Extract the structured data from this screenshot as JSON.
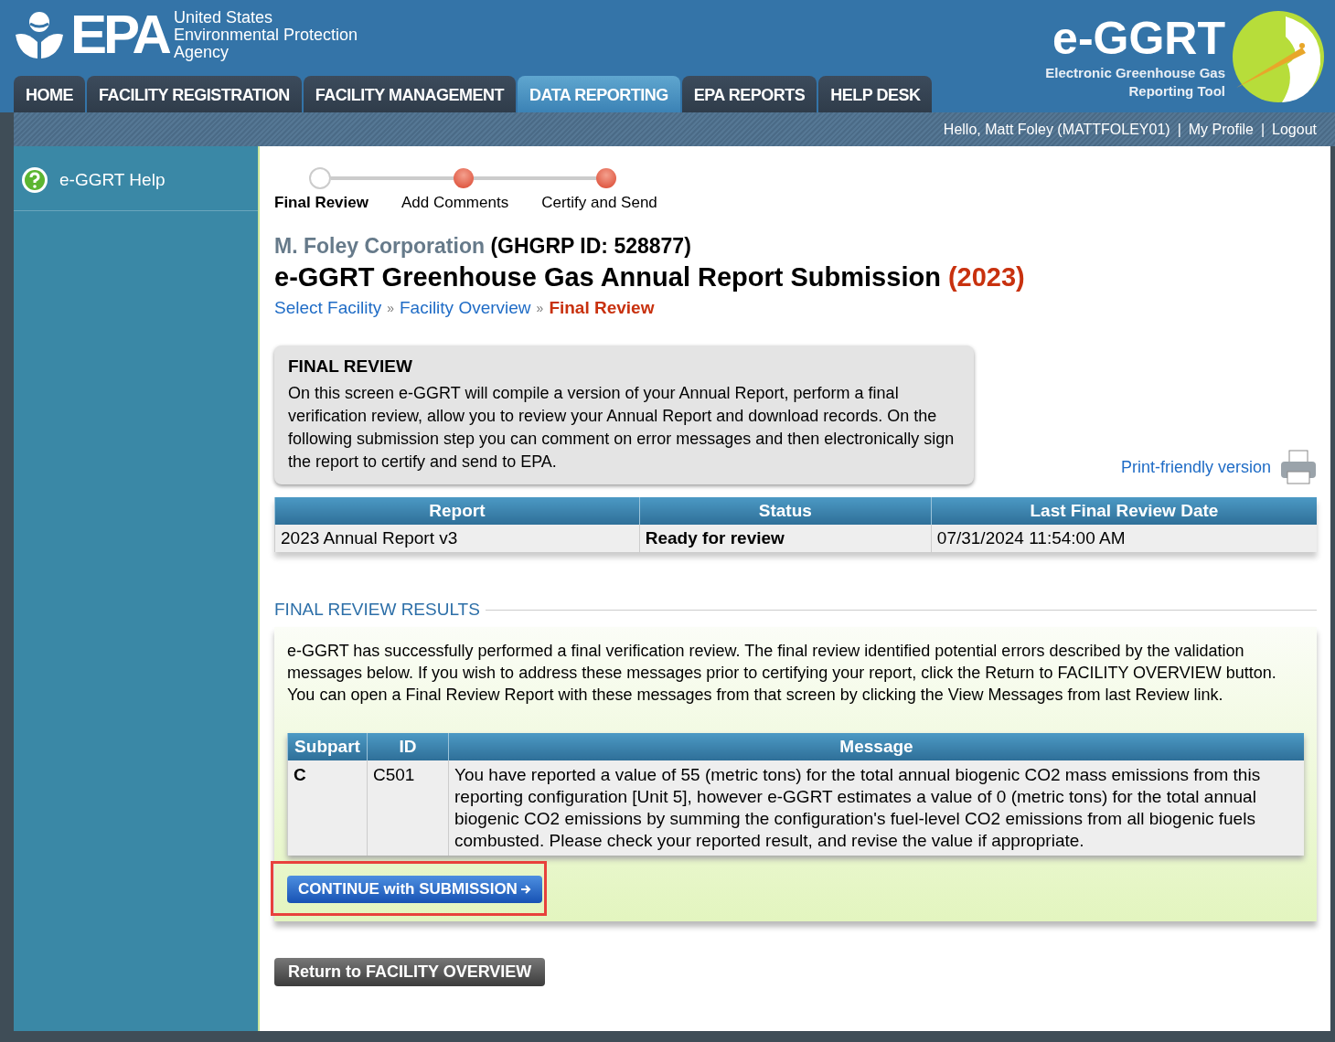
{
  "header": {
    "agency_lines": [
      "United States",
      "Environmental Protection",
      "Agency"
    ],
    "logo_text": "EPA",
    "app_logo": "e-GGRT",
    "app_subtitle_lines": [
      "Electronic Greenhouse Gas",
      "Reporting Tool"
    ]
  },
  "nav_tabs": [
    {
      "label": "HOME",
      "selected": false
    },
    {
      "label": "FACILITY REGISTRATION",
      "selected": false
    },
    {
      "label": "FACILITY MANAGEMENT",
      "selected": false
    },
    {
      "label": "DATA REPORTING",
      "selected": true
    },
    {
      "label": "EPA REPORTS",
      "selected": false
    },
    {
      "label": "HELP DESK",
      "selected": false
    }
  ],
  "user_bar": {
    "greeting": "Hello, Matt Foley (MATTFOLEY01)",
    "separator": "|",
    "links": [
      "My Profile",
      "Logout"
    ]
  },
  "breadcrumb_separator": "»",
  "sidebar": {
    "items": [
      {
        "label": "e-GGRT Help"
      }
    ]
  },
  "steps": [
    {
      "label": "Final Review",
      "selected": true
    },
    {
      "label": "Add Comments",
      "selected": false
    },
    {
      "label": "Certify and Send",
      "selected": false
    }
  ],
  "facility": {
    "name": "M. Foley Corporation",
    "id": "(GHGRP ID: 528877)"
  },
  "page_title": {
    "text": "e-GGRT Greenhouse Gas Annual Report Submission",
    "year": "(2023)"
  },
  "breadcrumbs": [
    {
      "label": "Select Facility",
      "selected": false
    },
    {
      "label": "Facility Overview",
      "selected": false
    },
    {
      "label": "Final Review",
      "selected": true
    }
  ],
  "info_box": {
    "title": "FINAL REVIEW",
    "text": "On this screen e-GGRT will compile a version of your Annual Report, perform a final verification review, allow you to review your Annual Report and download records. On the following submission step you can comment on error messages and then electronically sign the report to certify and send to EPA."
  },
  "print_link": "Print-friendly version",
  "report_table": {
    "columns": [
      "Report",
      "Status",
      "Last Final Review Date"
    ],
    "rows": [
      [
        {
          "text": "2023 Annual Report v3",
          "bold": false
        },
        {
          "text": "Ready for review",
          "bold": true
        },
        {
          "text": "07/31/2024 11:54:00 AM",
          "bold": false
        }
      ]
    ]
  },
  "results": {
    "heading": "FINAL REVIEW RESULTS",
    "text": "e-GGRT has successfully performed a final verification review. The final review identified potential errors described by the validation messages below. If you wish to address these messages prior to certifying your report, click the Return to FACILITY OVERVIEW button. You can open a Final Review Report with these messages from that screen by clicking the View Messages from last Review link.",
    "columns": [
      "Subpart",
      "ID",
      "Message"
    ],
    "rows": [
      [
        {
          "text": "C",
          "bold": true
        },
        {
          "text": "C501",
          "bold": false
        },
        {
          "text": "You have reported a value of 55 (metric tons) for the total annual biogenic CO2 mass emissions from this reporting configuration [Unit 5], however e-GGRT estimates a value of 0 (metric tons) for the total annual biogenic CO2 emissions by summing the configuration's fuel-level CO2 emissions from all biogenic fuels combusted. Please check your reported result, and revise the value if appropriate.",
          "bold": false
        }
      ]
    ],
    "continue_button": "CONTINUE with SUBMISSION",
    "highlighted": true
  },
  "return_button": "Return to FACILITY OVERVIEW"
}
